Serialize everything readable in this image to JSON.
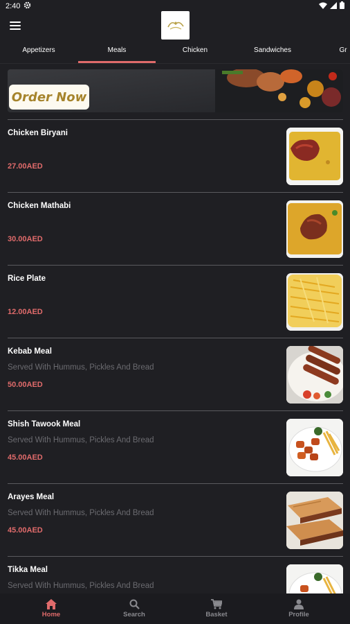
{
  "status_bar": {
    "time": "2:40"
  },
  "header": {
    "menu_icon": "hamburger-icon",
    "logo": "restaurant-logo"
  },
  "tabs": [
    {
      "label": "Appetizers",
      "active": false
    },
    {
      "label": "Meals",
      "active": true
    },
    {
      "label": "Chicken",
      "active": false
    },
    {
      "label": "Sandwiches",
      "active": false
    },
    {
      "label": "Gr",
      "active": false
    }
  ],
  "banner": {
    "button_label": "Order Now"
  },
  "items": [
    {
      "name": "Chicken Biryani",
      "description": "",
      "price": "27.00AED",
      "image": "chicken-biryani"
    },
    {
      "name": "Chicken Mathabi",
      "description": "",
      "price": "30.00AED",
      "image": "chicken-mathabi"
    },
    {
      "name": "Rice Plate",
      "description": "",
      "price": "12.00AED",
      "image": "rice-plate"
    },
    {
      "name": "Kebab Meal",
      "description": "Served With Hummus, Pickles And Bread",
      "price": "50.00AED",
      "image": "kebab-meal"
    },
    {
      "name": "Shish Tawook Meal",
      "description": "Served With Hummus, Pickles And Bread",
      "price": "45.00AED",
      "image": "shish-tawook"
    },
    {
      "name": "Arayes Meal",
      "description": "Served With Hummus, Pickles And Bread",
      "price": "45.00AED",
      "image": "arayes"
    },
    {
      "name": "Tikka Meal",
      "description": "Served With Hummus, Pickles And Bread",
      "price": "",
      "image": "tikka"
    }
  ],
  "bottom_nav": [
    {
      "label": "Home",
      "icon": "home-icon",
      "active": true
    },
    {
      "label": "Search",
      "icon": "search-icon",
      "active": false
    },
    {
      "label": "Basket",
      "icon": "cart-icon",
      "active": false
    },
    {
      "label": "Profile",
      "icon": "profile-icon",
      "active": false
    }
  ],
  "colors": {
    "accent": "#e06b6b",
    "background": "#1f1f23",
    "muted_text": "#6b6b70"
  }
}
